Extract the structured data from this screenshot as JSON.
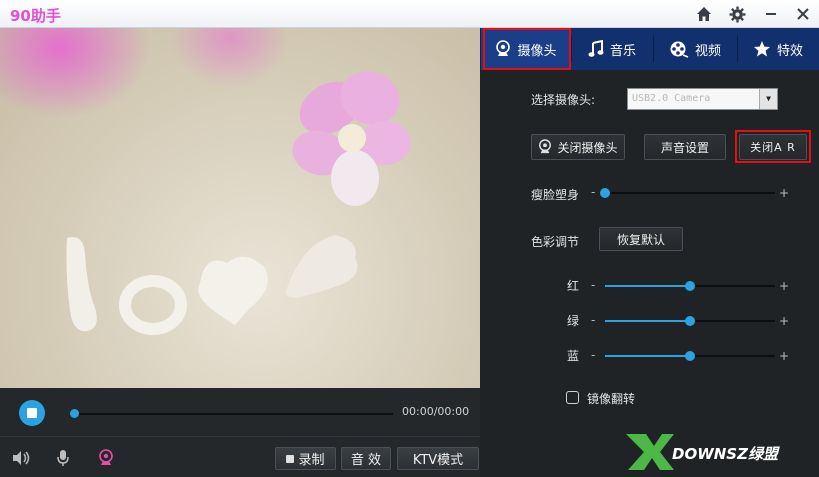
{
  "window": {
    "title": "90助手"
  },
  "titlebar": {
    "icons": [
      "home-icon",
      "gear-icon",
      "minimize-icon",
      "close-icon"
    ]
  },
  "player": {
    "time": "00:00/00:00",
    "progress": 0.0,
    "buttons": {
      "record": "录制",
      "effect": "音 效",
      "ktv": "KTV模式"
    }
  },
  "tabs": [
    {
      "label": "摄像头",
      "icon": "webcam-icon",
      "active": true
    },
    {
      "label": "音乐",
      "icon": "music-note-icon",
      "active": false
    },
    {
      "label": "视频",
      "icon": "film-reel-icon",
      "active": false
    },
    {
      "label": "特效",
      "icon": "star-icon",
      "active": false
    }
  ],
  "camera": {
    "select_label": "选择摄像头:",
    "select_value": "USB2.0 Camera",
    "close_camera": "关闭摄像头",
    "sound_settings": "声音设置",
    "close_ar": "关闭A R",
    "face_label": "瘦脸塑身",
    "face_value": 0.0,
    "color_label": "色彩调节",
    "reset": "恢复默认",
    "red_label": "红",
    "red_value": 0.5,
    "green_label": "绿",
    "green_value": 0.5,
    "blue_label": "蓝",
    "blue_value": 0.5,
    "mirror_label": "镜像翻转",
    "mirror_checked": false
  },
  "slider_signs": {
    "minus": "-",
    "plus": "+"
  },
  "watermark": {
    "text": "DOWNSZ绿盟"
  },
  "colors": {
    "accent": "#2aa3e0",
    "tab_bar": "#12306e",
    "highlight": "#e60d14",
    "title": "#e54fd6"
  }
}
